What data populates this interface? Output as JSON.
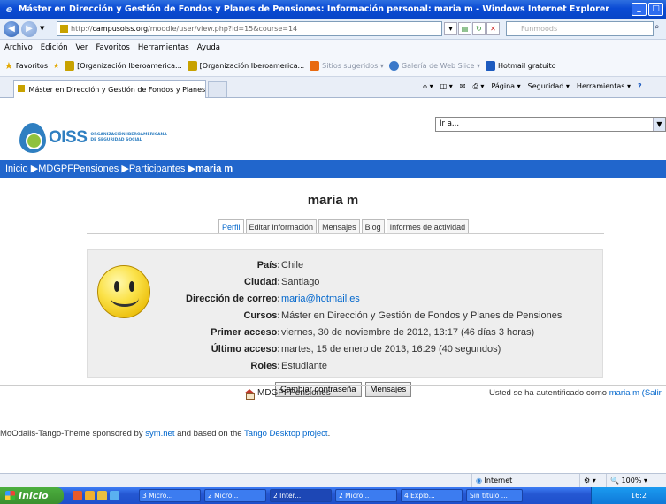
{
  "window": {
    "title": "Máster en Dirección y Gestión de Fondos y Planes de Pensiones: Información personal: maria m - Windows Internet Explorer"
  },
  "address": {
    "url_prefix": "http://",
    "url_domain": "campusoiss.org",
    "url_path": "/moodle/user/view.php?id=15&course=14",
    "search_placeholder": "Funmoods"
  },
  "menu": [
    "Archivo",
    "Edición",
    "Ver",
    "Favoritos",
    "Herramientas",
    "Ayuda"
  ],
  "favorites": {
    "label": "Favoritos",
    "items": [
      {
        "label": "[Organización Iberoamerica...",
        "dim": false
      },
      {
        "label": "[Organización Iberoamerica...",
        "dim": false
      },
      {
        "label": "Sitios sugeridos ▾",
        "dim": true
      },
      {
        "label": "Galería de Web Slice ▾",
        "dim": true
      },
      {
        "label": "Hotmail gratuito",
        "dim": false
      }
    ]
  },
  "browser_tab": {
    "label": "Máster en Dirección y Gestión de Fondos y Planes de ..."
  },
  "command_bar": [
    "Página ▾",
    "Seguridad ▾",
    "Herramientas ▾"
  ],
  "site": {
    "logo_text": "OISS",
    "logo_org": "ORGANIZACIÓN IBEROAMERICANA DE SEGURIDAD SOCIAL",
    "jump_select": "Ir a...",
    "breadcrumb": [
      "Inicio",
      "MDGPFPensiones",
      "Participantes",
      "maria m"
    ]
  },
  "profile": {
    "name": "maria m",
    "tabs": [
      "Perfil",
      "Editar información",
      "Mensajes",
      "Blog",
      "Informes de actividad"
    ],
    "rows": [
      {
        "label": "País:",
        "value": "Chile",
        "link": false
      },
      {
        "label": "Ciudad:",
        "value": "Santiago",
        "link": false
      },
      {
        "label": "Dirección de correo:",
        "value": "maria@hotmail.es",
        "link": true
      },
      {
        "label": "Cursos:",
        "value": "Máster en Dirección y Gestión de Fondos y Planes de Pensiones",
        "link": false
      },
      {
        "label": "Primer acceso:",
        "value": "viernes, 30 de noviembre de 2012, 13:17  (46 días 3 horas)",
        "link": false
      },
      {
        "label": "Último acceso:",
        "value": "martes, 15 de enero de 2013, 16:29  (40 segundos)",
        "link": false
      },
      {
        "label": "Roles:",
        "value": "Estudiante",
        "link": false
      }
    ],
    "buttons": {
      "change_password": "Cambiar contraseña",
      "messages": "Mensajes"
    }
  },
  "footer": {
    "home_link": "MDGPFPensiones",
    "auth_prefix": "Usted se ha autentificado como ",
    "auth_user": "maria m",
    "auth_logout": " (Salir",
    "sponsor_1": "MoOdalis-Tango-Theme sponsored by ",
    "sponsor_link1": "sym.net",
    "sponsor_2": " and based on the ",
    "sponsor_link2": "Tango Desktop project",
    "sponsor_3": "."
  },
  "statusbar": {
    "zone": "Internet",
    "zoom": "100%"
  },
  "taskbar": {
    "start": "Inicio",
    "tasks": [
      {
        "label": "3 Micro...",
        "active": false
      },
      {
        "label": "2 Micro...",
        "active": false
      },
      {
        "label": "2 Inter...",
        "active": true
      },
      {
        "label": "2 Micro...",
        "active": false
      },
      {
        "label": "4 Explo...",
        "active": false
      },
      {
        "label": "Sin título ...",
        "active": false
      }
    ],
    "clock": "16:2"
  }
}
